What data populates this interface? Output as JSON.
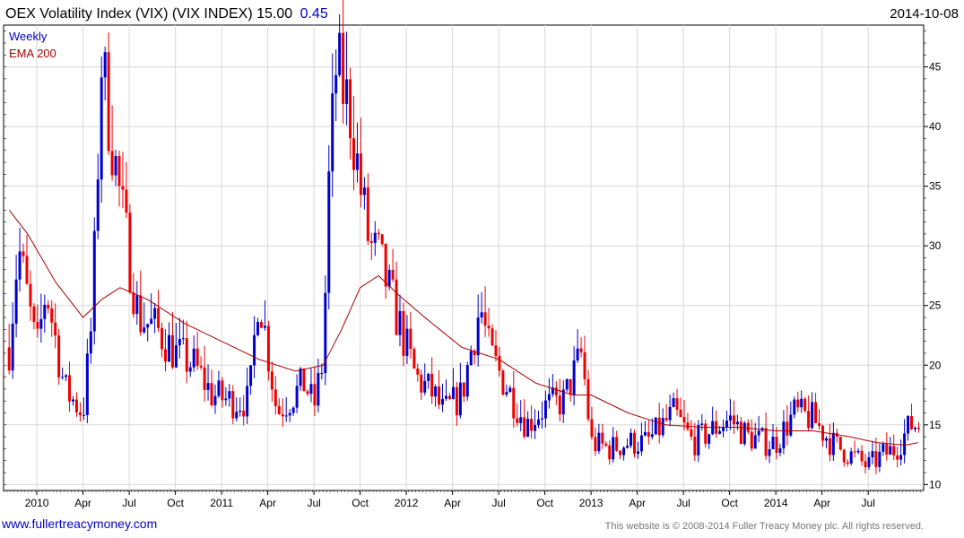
{
  "header": {
    "title": "OEX Volatility Index (VIX) (VIX INDEX) 15.00",
    "change": "0.45",
    "date": "2014-10-08"
  },
  "legend": {
    "weekly": "Weekly",
    "ema": "EMA 200"
  },
  "footer": {
    "website": "www.fullertreacymoney.com",
    "copyright": "This website is © 2008-2014 Fuller Treacy Money plc. All rights reserved."
  },
  "colors": {
    "up": "#0000cc",
    "down": "#ee0000",
    "ema": "#aa0000",
    "change": "#0000cc",
    "grid": "#d8d8d8"
  },
  "chart_data": {
    "type": "candlestick",
    "title": "OEX Volatility Index (VIX) (VIX INDEX) 15.00",
    "ylim": [
      9.5,
      48.5
    ],
    "yticks": [
      10,
      15,
      20,
      25,
      30,
      35,
      40,
      45
    ],
    "x_tick_labels": [
      "2010",
      "Apr",
      "Jul",
      "Oct",
      "2011",
      "Apr",
      "Jul",
      "Oct",
      "2012",
      "Apr",
      "Jul",
      "Oct",
      "2013",
      "Apr",
      "Jul",
      "Oct",
      "2014",
      "Apr",
      "Jul"
    ],
    "grid": true,
    "legend_position": "top-left",
    "series": [
      {
        "name": "Weekly",
        "representation": "weekly candles",
        "close_anchors": [
          [
            2009.85,
            21.5
          ],
          [
            2009.9,
            30.0
          ],
          [
            2010.0,
            21.0
          ],
          [
            2010.05,
            26.5
          ],
          [
            2010.15,
            18.0
          ],
          [
            2010.25,
            16.0
          ],
          [
            2010.3,
            24.0
          ],
          [
            2010.35,
            45.5
          ],
          [
            2010.45,
            34.0
          ],
          [
            2010.55,
            24.0
          ],
          [
            2010.65,
            23.0
          ],
          [
            2010.75,
            21.0
          ],
          [
            2010.85,
            20.0
          ],
          [
            2010.95,
            17.5
          ],
          [
            2011.05,
            17.0
          ],
          [
            2011.15,
            17.0
          ],
          [
            2011.2,
            26.5
          ],
          [
            2011.3,
            16.0
          ],
          [
            2011.45,
            18.5
          ],
          [
            2011.5,
            16.5
          ],
          [
            2011.55,
            20.5
          ],
          [
            2011.58,
            35.0
          ],
          [
            2011.62,
            45.0
          ],
          [
            2011.7,
            41.0
          ],
          [
            2011.75,
            35.0
          ],
          [
            2011.8,
            30.0
          ],
          [
            2011.85,
            29.0
          ],
          [
            2011.95,
            24.0
          ],
          [
            2012.05,
            19.0
          ],
          [
            2012.15,
            17.5
          ],
          [
            2012.2,
            16.0
          ],
          [
            2012.3,
            17.5
          ],
          [
            2012.4,
            25.0
          ],
          [
            2012.45,
            21.0
          ],
          [
            2012.55,
            18.0
          ],
          [
            2012.65,
            15.0
          ],
          [
            2012.75,
            16.5
          ],
          [
            2012.85,
            17.0
          ],
          [
            2012.95,
            21.0
          ],
          [
            2013.0,
            13.5
          ],
          [
            2013.1,
            13.0
          ],
          [
            2013.2,
            13.5
          ],
          [
            2013.3,
            13.5
          ],
          [
            2013.45,
            16.0
          ],
          [
            2013.55,
            13.5
          ],
          [
            2013.65,
            14.5
          ],
          [
            2013.75,
            15.5
          ],
          [
            2013.85,
            14.0
          ],
          [
            2013.95,
            13.5
          ],
          [
            2014.0,
            13.5
          ],
          [
            2014.1,
            16.0
          ],
          [
            2014.2,
            15.5
          ],
          [
            2014.3,
            13.5
          ],
          [
            2014.4,
            12.5
          ],
          [
            2014.5,
            11.5
          ],
          [
            2014.58,
            12.5
          ],
          [
            2014.65,
            13.0
          ],
          [
            2014.73,
            15.0
          ]
        ]
      },
      {
        "name": "EMA 200",
        "y_anchors": [
          [
            2009.85,
            33.0
          ],
          [
            2009.95,
            31.0
          ],
          [
            2010.1,
            27.0
          ],
          [
            2010.25,
            24.0
          ],
          [
            2010.35,
            25.5
          ],
          [
            2010.45,
            26.5
          ],
          [
            2010.6,
            25.5
          ],
          [
            2010.8,
            23.5
          ],
          [
            2011.0,
            22.0
          ],
          [
            2011.2,
            20.5
          ],
          [
            2011.4,
            19.5
          ],
          [
            2011.55,
            20.0
          ],
          [
            2011.65,
            23.0
          ],
          [
            2011.75,
            26.5
          ],
          [
            2011.85,
            27.5
          ],
          [
            2011.95,
            26.0
          ],
          [
            2012.1,
            24.0
          ],
          [
            2012.3,
            21.5
          ],
          [
            2012.5,
            20.5
          ],
          [
            2012.7,
            18.5
          ],
          [
            2012.9,
            17.5
          ],
          [
            2013.0,
            17.5
          ],
          [
            2013.2,
            16.0
          ],
          [
            2013.4,
            15.0
          ],
          [
            2013.6,
            14.8
          ],
          [
            2013.8,
            14.8
          ],
          [
            2014.0,
            14.5
          ],
          [
            2014.2,
            14.5
          ],
          [
            2014.4,
            14.0
          ],
          [
            2014.55,
            13.5
          ],
          [
            2014.7,
            13.3
          ],
          [
            2014.77,
            13.5
          ]
        ]
      }
    ]
  }
}
